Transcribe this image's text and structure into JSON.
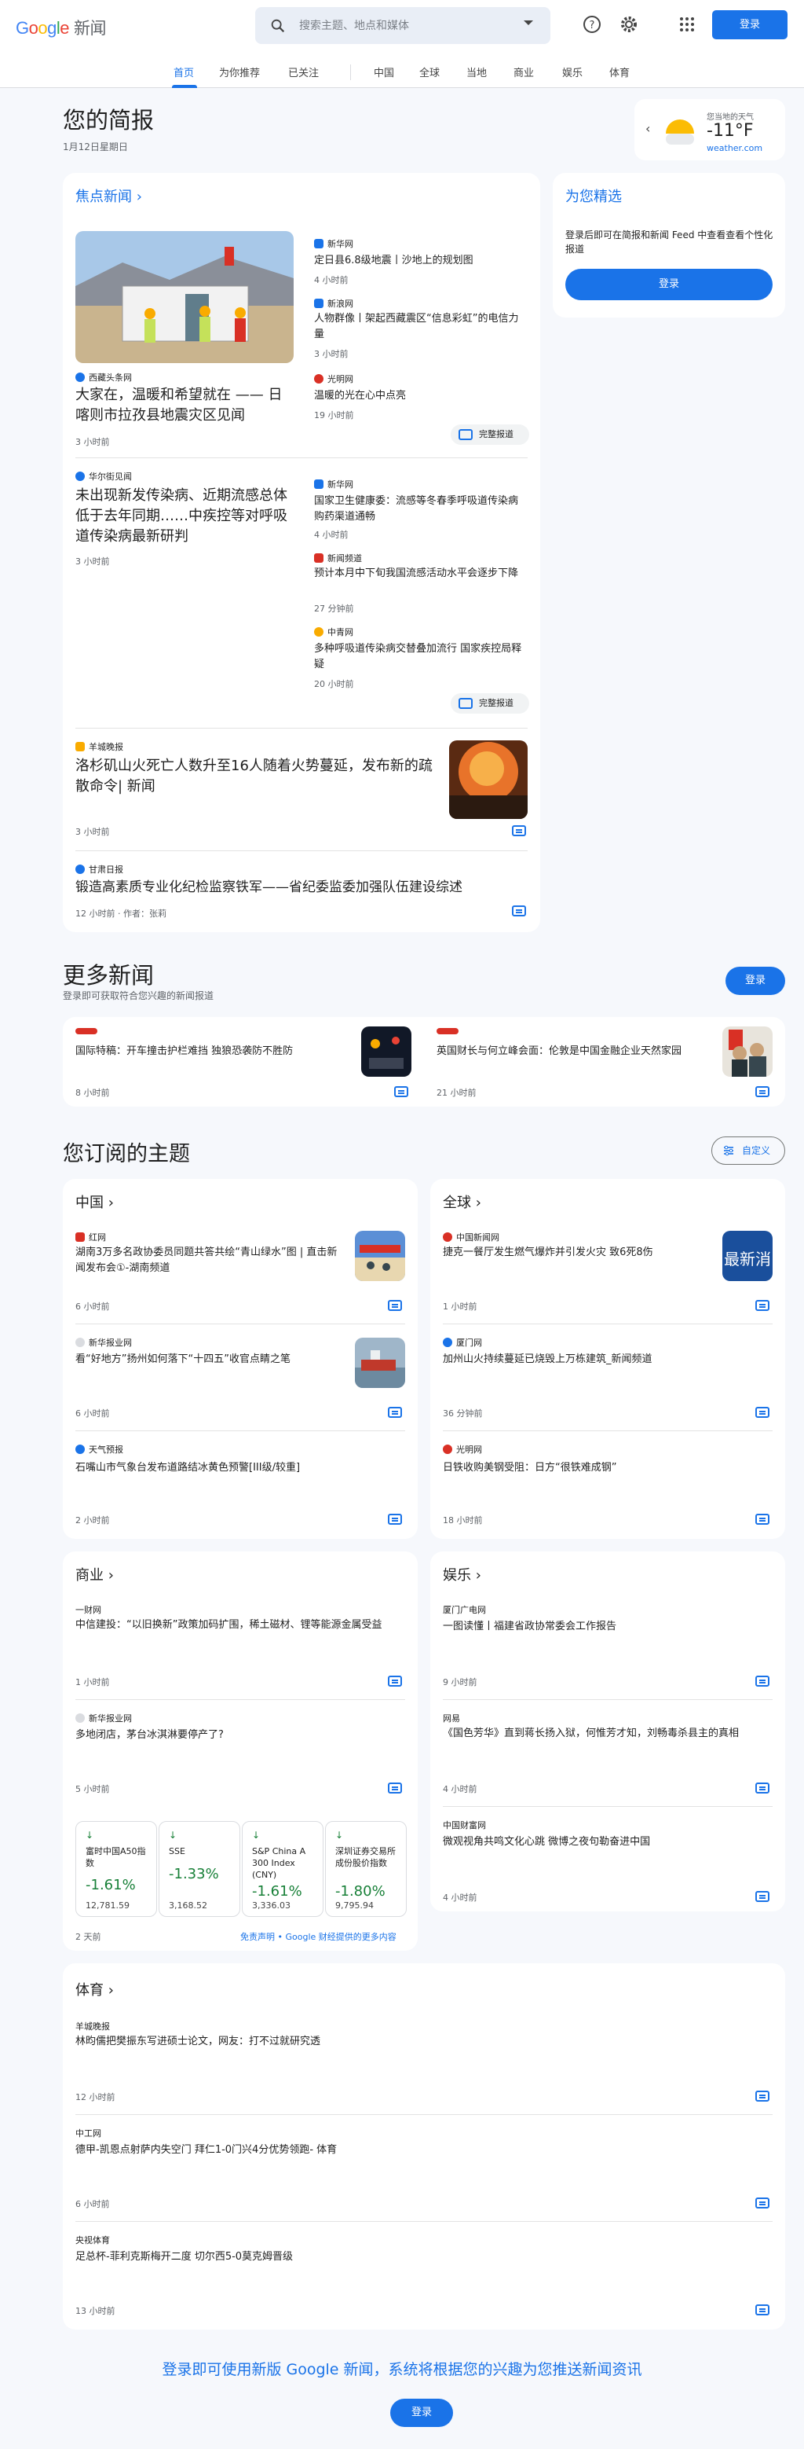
{
  "header": {
    "logo_brand": "Google",
    "logo_product": "新闻",
    "search_placeholder": "搜索主题、地点和媒体",
    "signin_label": "登录"
  },
  "nav": {
    "tabs": [
      "首页",
      "为你推荐",
      "已关注",
      "中国",
      "全球",
      "当地",
      "商业",
      "娱乐",
      "体育"
    ],
    "active_index": 0
  },
  "briefing": {
    "title": "您的简报",
    "date": "1月12日星期日"
  },
  "weather": {
    "label": "您当地的天气",
    "temp": "-11°F",
    "source": "weather.com"
  },
  "top_stories": {
    "title": "焦点新闻",
    "full_coverage": "完整报道",
    "cluster1": {
      "main_source": "西藏头条网",
      "main_headline": "大家在，温暖和希望就在 —— 日喀则市拉孜县地震灾区见闻",
      "main_time": "3 小时前",
      "side": [
        {
          "source": "新华网",
          "headline": "定日县6.8级地震丨沙地上的规划图",
          "time": "4 小时前"
        },
        {
          "source": "新浪网",
          "headline": "人物群像丨架起西藏震区“信息彩虹”的电信力量",
          "time": "3 小时前"
        },
        {
          "source": "光明网",
          "headline": "温暖的光在心中点亮",
          "time": "19 小时前"
        }
      ]
    },
    "cluster2": {
      "main_source": "华尔街见闻",
      "main_headline": "未出现新发传染病、近期流感总体低于去年同期……中疾控等对呼吸道传染病最新研判",
      "main_time": "3 小时前",
      "side": [
        {
          "source": "新华网",
          "headline": "国家卫生健康委：流感等冬春季呼吸道传染病购药渠道通畅",
          "time": "4 小时前"
        },
        {
          "source": "新闻频道",
          "headline": "预计本月中下旬我国流感活动水平会逐步下降",
          "time": "27 分钟前"
        },
        {
          "source": "中青网",
          "headline": "多种呼吸道传染病交替叠加流行 国家疾控局释疑",
          "time": "20 小时前"
        }
      ]
    },
    "story3": {
      "source": "羊城晚报",
      "headline": "洛杉矶山火死亡人数升至16人随着火势蔓延，发布新的疏散命令| 新闻",
      "time": "3 小时前"
    },
    "story4": {
      "source": "甘肃日报",
      "headline": "锻造高素质专业化纪检监察铁军——省纪委监委加强队伍建设综述",
      "time": "12 小时前 · 作者：张莉"
    }
  },
  "picks": {
    "title": "为您精选",
    "text": "登录后即可在简报和新闻 Feed 中查看查看个性化报道",
    "button": "登录"
  },
  "more_news": {
    "title": "更多新闻",
    "subtitle": "登录即可获取符合您兴趣的新闻报道",
    "button": "登录",
    "items": [
      {
        "headline": "国际特稿：开车撞击护栏难挡 独狼恐袭防不胜防",
        "time": "8 小时前"
      },
      {
        "headline": "英国财长与何立峰会面：伦敦是中国金融企业天然家园",
        "time": "21 小时前"
      }
    ]
  },
  "topics": {
    "title": "您订阅的主题",
    "customize": "自定义",
    "china": {
      "title": "中国",
      "items": [
        {
          "source": "红网",
          "headline": "湖南3万多名政协委员同题共答共绘“青山绿水”图 | 直击新闻发布会①-湖南频道",
          "time": "6 小时前"
        },
        {
          "source": "新华报业网",
          "headline": "看“好地方”扬州如何落下“十四五”收官点睛之笔",
          "time": "6 小时前"
        },
        {
          "source": "天气预报",
          "headline": "石嘴山市气象台发布道路结冰黄色预警[III级/较重]",
          "time": "2 小时前"
        }
      ]
    },
    "world": {
      "title": "全球",
      "items": [
        {
          "source": "中国新闻网",
          "headline": "捷克一餐厅发生燃气爆炸并引发火灾 致6死8伤",
          "time": "1 小时前",
          "thumb_text": "最新消"
        },
        {
          "source": "厦门网",
          "headline": "加州山火持续蔓延已烧毁上万栋建筑_新闻频道",
          "time": "36 分钟前"
        },
        {
          "source": "光明网",
          "headline": "日铁收购美钢受阻：日方“很铁难成钢”",
          "time": "18 小时前"
        }
      ]
    },
    "business": {
      "title": "商业",
      "items": [
        {
          "source": "一财网",
          "headline": "中信建投：“以旧换新”政策加码扩围，稀土磁材、锂等能源金属受益",
          "time": "1 小时前"
        },
        {
          "source": "新华报业网",
          "headline": "多地闭店，茅台冰淇淋要停产了?",
          "time": "5 小时前"
        }
      ],
      "stocks": [
        {
          "name": "富时中国A50指数",
          "change": "-1.61%",
          "value": "12,781.59"
        },
        {
          "name": "SSE",
          "change": "-1.33%",
          "value": "3,168.52"
        },
        {
          "name": "S&P China A 300 Index (CNY)",
          "change": "-1.61%",
          "value": "3,336.03"
        },
        {
          "name": "深圳证券交易所成份股价指数",
          "change": "-1.80%",
          "value": "9,795.94"
        }
      ],
      "stock_time": "2 天前",
      "disclaimer": "免责声明 • Google 财经提供的更多内容"
    },
    "entertainment": {
      "title": "娱乐",
      "items": [
        {
          "source": "厦门广电网",
          "headline": "一图读懂丨福建省政协常委会工作报告",
          "time": "9 小时前"
        },
        {
          "source": "网易",
          "headline": "《国色芳华》直到蒋长扬入狱，何惟芳才知，刘畅毒杀县主的真相",
          "time": "4 小时前"
        },
        {
          "source": "中国财富网",
          "headline": "微观视角共鸣文化心跳 微博之夜句勒奋进中国",
          "time": "4 小时前"
        }
      ]
    },
    "sports": {
      "title": "体育",
      "items": [
        {
          "source": "羊城晚报",
          "headline": "林昀儒把樊振东写进硕士论文，网友：打不过就研究透",
          "time": "12 小时前"
        },
        {
          "source": "中工网",
          "headline": "德甲-凯恩点射萨内失空门 拜仁1-0门兴4分优势领跑- 体育",
          "time": "6 小时前"
        },
        {
          "source": "央视体育",
          "headline": "足总杯-菲利克斯梅开二度 切尔西5-0莫克姆晋级",
          "time": "13 小时前"
        }
      ]
    }
  },
  "footer": {
    "text": "登录即可使用新版 Google 新闻，系统将根据您的兴趣为您推送新闻资讯",
    "button": "登录"
  },
  "colors": {
    "accent": "#1a73e8",
    "stock_down": "#188038",
    "background": "#f6f8fc"
  },
  "icons": [
    "search-icon",
    "dropdown-arrow-icon",
    "help-icon",
    "settings-icon",
    "apps-grid-icon",
    "chevron-right-icon",
    "sun-icon",
    "full-coverage-icon",
    "sliders-icon"
  ]
}
